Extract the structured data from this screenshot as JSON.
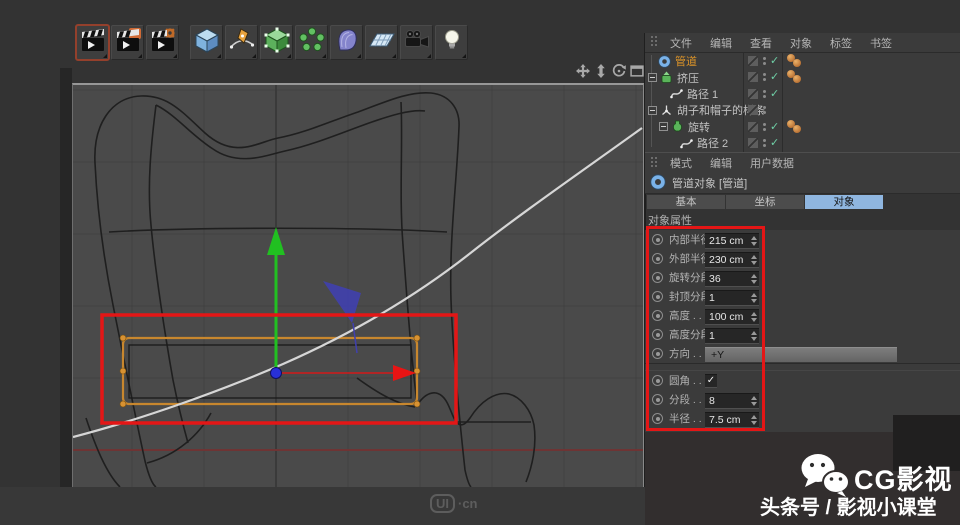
{
  "toolbar": {
    "tiles": [
      {
        "name": "render-view",
        "active": true
      },
      {
        "name": "render-to-picture-viewer",
        "active": false
      },
      {
        "name": "render-settings",
        "active": false
      },
      {
        "name": "add-cube-primitive",
        "active": false
      },
      {
        "name": "spline-pen",
        "active": false
      },
      {
        "name": "make-editable",
        "active": false
      },
      {
        "name": "array-modeling",
        "active": false
      },
      {
        "name": "deformer",
        "active": false
      },
      {
        "name": "floor-environment",
        "active": false
      },
      {
        "name": "camera",
        "active": false
      },
      {
        "name": "light",
        "active": false
      }
    ]
  },
  "viewport": {
    "nav_icons": [
      "pan",
      "dolly",
      "rotate",
      "maximize"
    ],
    "axis_values": {
      "x_axis_color": "#e81414",
      "y_axis_color": "#21c021",
      "z_axis_color": "#4040ae"
    }
  },
  "object_manager": {
    "menu": [
      "文件",
      "编辑",
      "查看",
      "对象",
      "标签",
      "书签"
    ],
    "tree": [
      {
        "label": "管道",
        "icon": "tube",
        "selected": true,
        "enabled": true,
        "tags": 2
      },
      {
        "label": "挤压",
        "icon": "extrude",
        "selected": false,
        "enabled": true,
        "tags": 2
      },
      {
        "label": "路径 1",
        "icon": "spline",
        "selected": false,
        "enabled": true,
        "tags": 0
      },
      {
        "label": "胡子和帽子的样条",
        "icon": "null",
        "selected": false,
        "enabled": false,
        "tags": 0
      },
      {
        "label": "旋转",
        "icon": "lathe",
        "selected": false,
        "enabled": true,
        "tags": 2
      },
      {
        "label": "路径 2",
        "icon": "spline",
        "selected": false,
        "enabled": true,
        "tags": 0
      }
    ]
  },
  "attribute_manager": {
    "menu": [
      "模式",
      "编辑",
      "用户数据"
    ],
    "title": "管道对象 [管道]",
    "tabs": [
      "基本",
      "坐标",
      "对象"
    ],
    "active_tab": "对象",
    "section": "对象属性",
    "rows": [
      {
        "label": "内部半径",
        "value": "215 cm",
        "type": "number"
      },
      {
        "label": "外部半径",
        "value": "230 cm",
        "type": "number"
      },
      {
        "label": "旋转分段",
        "value": "36",
        "type": "number"
      },
      {
        "label": "封顶分段",
        "value": "1",
        "type": "number"
      },
      {
        "label": "高度 . . .",
        "value": "100 cm",
        "type": "number"
      },
      {
        "label": "高度分段",
        "value": "1",
        "type": "number"
      },
      {
        "label": "方向 . . .",
        "value": "+Y",
        "type": "dropdown"
      },
      {
        "label": "圆角 . . .",
        "value": "✓",
        "type": "checkbox",
        "checked": true
      },
      {
        "label": "分段 . . .",
        "value": "8",
        "type": "number"
      },
      {
        "label": "半径 . . .",
        "value": "7.5 cm",
        "type": "number"
      }
    ]
  },
  "branding": {
    "name": "CG影视",
    "subtitle": "头条号 / 影视小课堂"
  },
  "site_watermark": {
    "badge": "UI",
    "suffix": "·cn"
  },
  "colors": {
    "annotation_red": "#e41616",
    "selection_orange": "#c8872e",
    "tab_active_blue": "#8fb6e0",
    "grid_axis_red": "#6e3434",
    "enable_check_green": "#6fcfa6",
    "tag_orange": "#c87a32",
    "selected_label_orange": "#dd9428"
  }
}
